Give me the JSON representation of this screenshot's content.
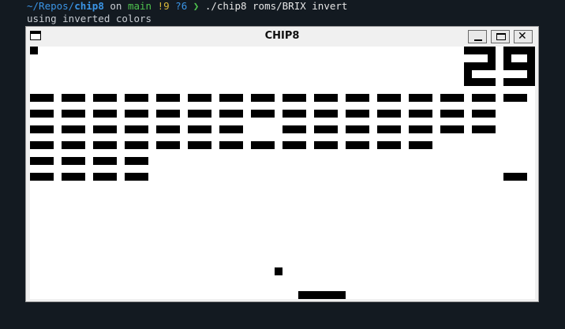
{
  "terminal": {
    "path_prefix": "~/Repos/",
    "repo": "chip8",
    "on_text": " on ",
    "branch": "main",
    "modified": " !9",
    "untracked": " ?6",
    "arrow": " ❯ ",
    "command": "./chip8 roms/BRIX invert",
    "output": "using inverted colors"
  },
  "window": {
    "title": "CHIP8",
    "icons": {
      "system": "window-menu-icon",
      "minimize": "minimize-icon",
      "maximize": "maximize-icon",
      "close": "close-icon"
    },
    "close_glyph": "✕"
  },
  "game": {
    "name": "BRIX",
    "score": "29",
    "lives_shown": 1,
    "display_cols": 64,
    "display_rows": 32,
    "inverted_colors": true,
    "bricks": [
      [
        1,
        1,
        1,
        1,
        1,
        1,
        1,
        1,
        1,
        1,
        1,
        1,
        1,
        1,
        1,
        1
      ],
      [
        1,
        1,
        1,
        1,
        1,
        1,
        1,
        1,
        1,
        1,
        1,
        1,
        1,
        1,
        1,
        0
      ],
      [
        1,
        1,
        1,
        1,
        1,
        1,
        1,
        0,
        1,
        1,
        1,
        1,
        1,
        1,
        1,
        0
      ],
      [
        1,
        1,
        1,
        1,
        1,
        1,
        1,
        1,
        1,
        1,
        1,
        1,
        1,
        0,
        0,
        0
      ],
      [
        1,
        1,
        1,
        1,
        0,
        0,
        0,
        0,
        0,
        0,
        0,
        0,
        0,
        0,
        0,
        0
      ],
      [
        1,
        1,
        1,
        1,
        0,
        0,
        0,
        0,
        0,
        0,
        0,
        0,
        0,
        0,
        0,
        1
      ]
    ],
    "ball": {
      "col": 31,
      "row": 28
    },
    "paddle": {
      "col": 34,
      "row": 31,
      "width_cols": 6
    }
  }
}
